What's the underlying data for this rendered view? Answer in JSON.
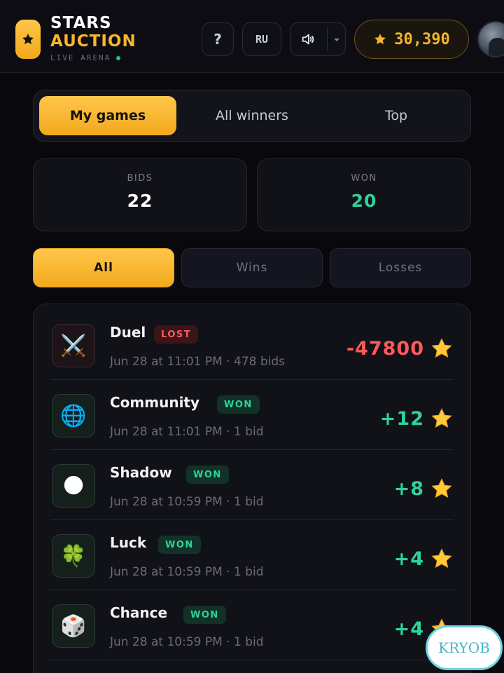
{
  "header": {
    "brand_line1": "STARS",
    "brand_line2": "AUCTION",
    "brand_tagline": "LIVE ARENA",
    "help_label": "?",
    "language": "RU",
    "balance": "30,390",
    "icons": [
      "star-icon",
      "speaker-icon",
      "chevron-down-icon",
      "avatar"
    ]
  },
  "tabs": [
    {
      "label": "My games",
      "active": true
    },
    {
      "label": "All winners",
      "active": false
    },
    {
      "label": "Top",
      "active": false
    }
  ],
  "stats": {
    "bids_label": "BIDS",
    "bids_value": "22",
    "won_label": "WON",
    "won_value": "20"
  },
  "filters": [
    {
      "label": "All",
      "active": true
    },
    {
      "label": "Wins",
      "active": false
    },
    {
      "label": "Losses",
      "active": false
    }
  ],
  "games": [
    {
      "name": "Duel",
      "status": "LOST",
      "meta": "Jun 28 at 11:01 PM · 478 bids",
      "result": "-47800",
      "icon": "⚔️"
    },
    {
      "name": "Community",
      "status": "WON",
      "meta": "Jun 28 at 11:01 PM · 1 bid",
      "result": "+12",
      "icon": "🌐"
    },
    {
      "name": "Shadow",
      "status": "WON",
      "meta": "Jun 28 at 10:59 PM · 1 bid",
      "result": "+8",
      "icon": "🌑"
    },
    {
      "name": "Luck",
      "status": "WON",
      "meta": "Jun 28 at 10:59 PM · 1 bid",
      "result": "+4",
      "icon": "🍀"
    },
    {
      "name": "Chance",
      "status": "WON",
      "meta": "Jun 28 at 10:59 PM · 1 bid",
      "result": "+4",
      "icon": "🎲"
    }
  ],
  "colors": {
    "accent": "#f7b52b",
    "win": "#2ed39a",
    "loss": "#ff5a5a",
    "background": "#09090d"
  },
  "watermark": "KRYOB"
}
